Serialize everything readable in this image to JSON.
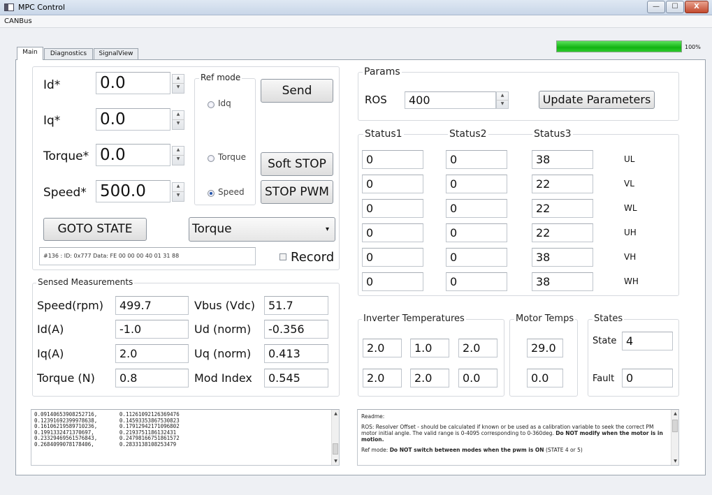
{
  "window": {
    "title": "MPC Control",
    "min": "—",
    "max": "☐",
    "close": "X"
  },
  "menu": {
    "canbus": "CANBus"
  },
  "tabs": [
    {
      "label": "Main"
    },
    {
      "label": "Diagnostics"
    },
    {
      "label": "SignalView"
    }
  ],
  "progress": {
    "value": 100,
    "label": "100%",
    "color": "#22c022"
  },
  "setpoints": {
    "id_label": "Id*",
    "id_value": "0.0",
    "iq_label": "Iq*",
    "iq_value": "0.0",
    "torque_label": "Torque*",
    "torque_value": "0.0",
    "speed_label": "Speed*",
    "speed_value": "500.0"
  },
  "ref_mode": {
    "title": "Ref mode",
    "idq": "Idq",
    "torque": "Torque",
    "speed": "Speed",
    "selected": "Speed"
  },
  "buttons": {
    "send": "Send",
    "soft_stop": "Soft STOP",
    "stop_pwm": "STOP PWM",
    "goto_state": "GOTO STATE",
    "update_params": "Update Parameters"
  },
  "state_select": {
    "value": "Torque",
    "arrow": "▾"
  },
  "can_message": "#136 : ID: 0x777 Data: FE 00 00 00 40 01 31 88",
  "record": {
    "label": "Record",
    "checked": false
  },
  "sensed": {
    "title": "Sensed Measurements",
    "rows": [
      {
        "l1": "Speed(rpm)",
        "v1": "499.7",
        "l2": "Vbus (Vdc)",
        "v2": "51.7"
      },
      {
        "l1": "Id(A)",
        "v1": "-1.0",
        "l2": "Ud (norm)",
        "v2": "-0.356"
      },
      {
        "l1": "Iq(A)",
        "v1": "2.0",
        "l2": "Uq (norm)",
        "v2": "0.413"
      },
      {
        "l1": "Torque (N)",
        "v1": "0.8",
        "l2": "Mod Index",
        "v2": "0.545"
      }
    ]
  },
  "params": {
    "title": "Params",
    "ros_label": "ROS",
    "ros_value": "400"
  },
  "status": {
    "headers": [
      "Status1",
      "Status2",
      "Status3"
    ],
    "rows": [
      {
        "s1": "0",
        "s2": "0",
        "s3": "38",
        "tag": "UL"
      },
      {
        "s1": "0",
        "s2": "0",
        "s3": "22",
        "tag": "VL"
      },
      {
        "s1": "0",
        "s2": "0",
        "s3": "22",
        "tag": "WL"
      },
      {
        "s1": "0",
        "s2": "0",
        "s3": "22",
        "tag": "UH"
      },
      {
        "s1": "0",
        "s2": "0",
        "s3": "38",
        "tag": "VH"
      },
      {
        "s1": "0",
        "s2": "0",
        "s3": "38",
        "tag": "WH"
      }
    ]
  },
  "inverter_temps": {
    "title": "Inverter Temperatures",
    "values": [
      "2.0",
      "1.0",
      "2.0",
      "2.0",
      "2.0",
      "0.0"
    ]
  },
  "motor_temps": {
    "title": "Motor Temps",
    "values": [
      "29.0",
      "0.0"
    ]
  },
  "states": {
    "title": "States",
    "state_label": "State",
    "state_value": "4",
    "fault_label": "Fault",
    "fault_value": "0"
  },
  "data_log": [
    "0.09140653908252716,       0.11261092126369476",
    "0.12391692399978638,       0.14593353867530823",
    "0.16106219589710236,       0.17912942171096802",
    "0.1991332471370697,        0.2193751186132431",
    "0.23329469561576843,       0.24798166751861572",
    "0.2684099078178406,        0.2833138108253479"
  ],
  "readme": {
    "heading": "Readme:",
    "ros_text": "ROS: Resolver Offset - should be calculated if known or be used as a calibration variable to seek the correct PM motor initial angle. The valid range is 0-4095 corresponding to 0-360deg.",
    "ros_bold": "Do NOT modify when the motor is in motion.",
    "refmode_text": "Ref mode:",
    "refmode_bold": "Do NOT switch between modes when the pwm is ON",
    "refmode_tail": "(STATE 4 or 5)"
  },
  "icons": {
    "up": "▲",
    "down": "▼"
  }
}
